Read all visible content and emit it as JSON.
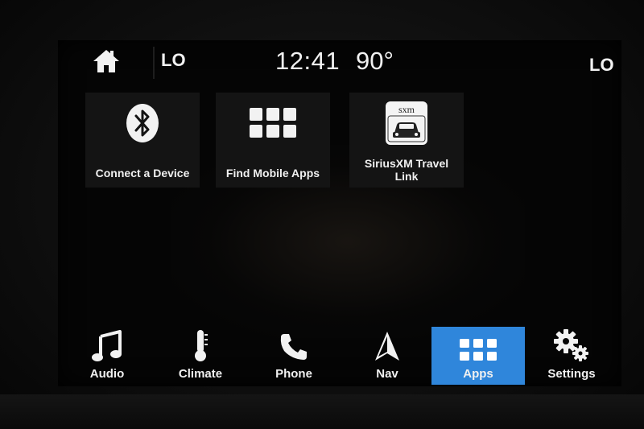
{
  "status": {
    "temp_left": "LO",
    "clock": "12:41",
    "outside_temp": "90°",
    "temp_right": "LO"
  },
  "tiles": [
    {
      "label": "Connect a Device",
      "icon": "bluetooth-icon"
    },
    {
      "label": "Find Mobile Apps",
      "icon": "apps-grid-icon"
    },
    {
      "label": "SiriusXM Travel Link",
      "icon": "sxm-travel-link-icon",
      "icon_text": "sxm"
    }
  ],
  "nav": [
    {
      "label": "Audio",
      "icon": "music-note-icon"
    },
    {
      "label": "Climate",
      "icon": "thermometer-icon"
    },
    {
      "label": "Phone",
      "icon": "phone-icon"
    },
    {
      "label": "Nav",
      "icon": "navigation-arrow-icon"
    },
    {
      "label": "Apps",
      "icon": "apps-grid-icon",
      "active": true
    },
    {
      "label": "Settings",
      "icon": "gears-icon"
    }
  ],
  "colors": {
    "accent": "#2f86db",
    "text": "#f0f0f0",
    "tile_bg": "#141414"
  }
}
